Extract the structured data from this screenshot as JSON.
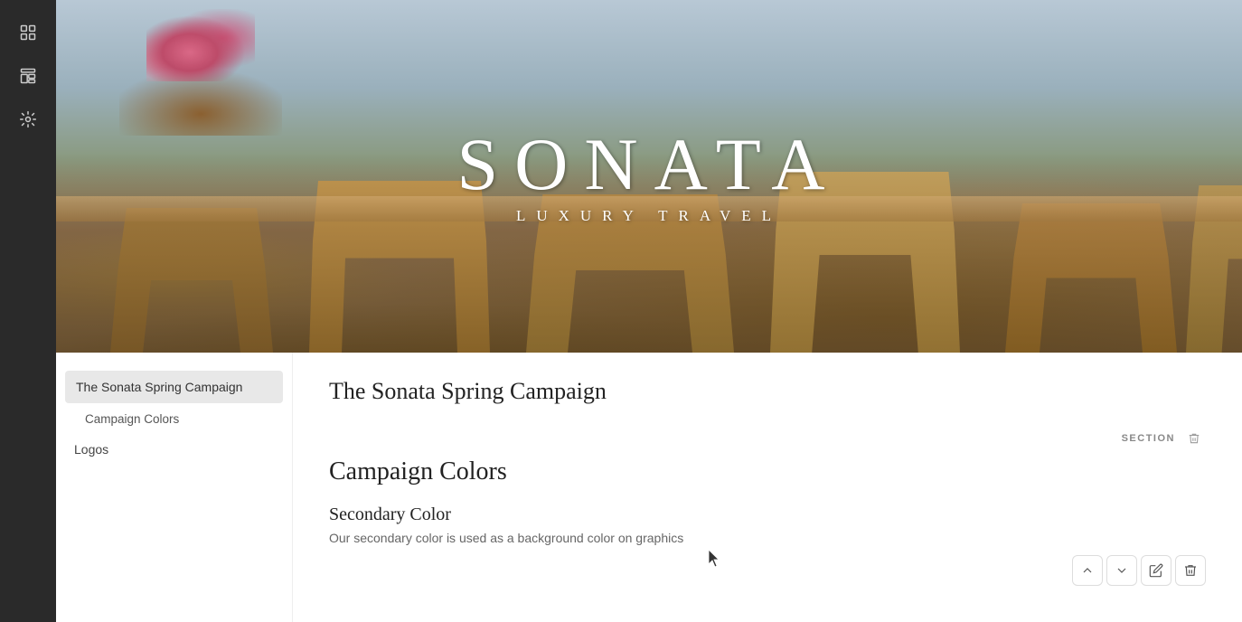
{
  "sidebar": {
    "icons": [
      {
        "name": "grid-icon",
        "symbol": "grid"
      },
      {
        "name": "template-icon",
        "symbol": "template"
      },
      {
        "name": "settings-icon",
        "symbol": "settings"
      }
    ]
  },
  "hero": {
    "logo_main": "SONATA",
    "logo_sub": "LUXURY TRAVEL"
  },
  "nav": {
    "items": [
      {
        "id": "main-title",
        "label": "The Sonata Spring Campaign",
        "level": "active"
      },
      {
        "id": "campaign-colors",
        "label": "Campaign Colors",
        "level": "sub"
      },
      {
        "id": "logos",
        "label": "Logos",
        "level": "top-level"
      }
    ]
  },
  "content": {
    "page_title": "The Sonata Spring Campaign",
    "section_label": "SECTION",
    "section_title": "Campaign Colors",
    "secondary_color_title": "Secondary Color",
    "secondary_color_desc": "Our secondary color is used as a background color on graphics"
  },
  "toolbar": {
    "up_label": "▲",
    "down_label": "▼",
    "edit_label": "✎",
    "delete_label": "🗑"
  }
}
